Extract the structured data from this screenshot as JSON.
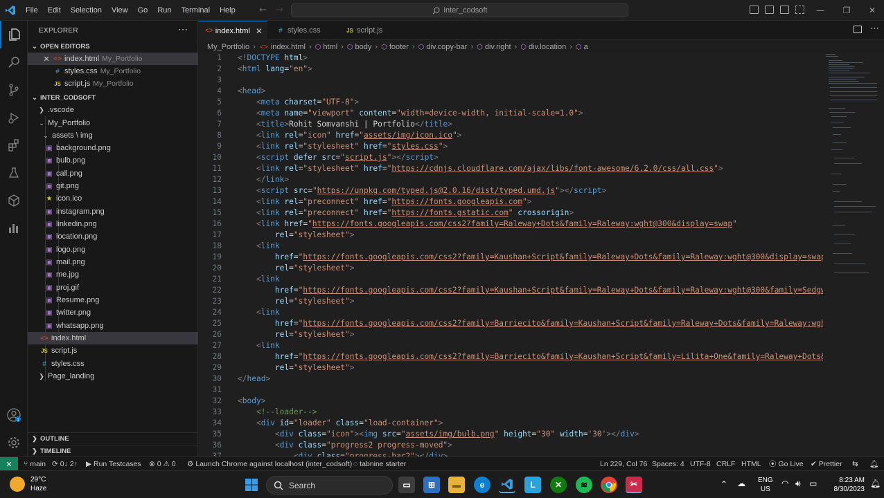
{
  "titlebar": {
    "menu": [
      "File",
      "Edit",
      "Selection",
      "View",
      "Go",
      "Run",
      "Terminal",
      "Help"
    ],
    "search": "inter_codsoft"
  },
  "sidebar": {
    "title": "EXPLORER",
    "open_editors_label": "OPEN EDITORS",
    "open_editors": [
      {
        "name": "index.html",
        "folder": "My_Portfolio",
        "icon": "html-file-icon"
      },
      {
        "name": "styles.css",
        "folder": "My_Portfolio",
        "icon": "css-file-icon"
      },
      {
        "name": "script.js",
        "folder": "My_Portfolio",
        "icon": "js-file-icon"
      }
    ],
    "workspace_label": "INTER_CODSOFT",
    "tree": [
      {
        "name": ".vscode"
      },
      {
        "name": "My_Portfolio"
      },
      {
        "name": "assets \\ img"
      },
      {
        "name": "background.png"
      },
      {
        "name": "bulb.png"
      },
      {
        "name": "call.png"
      },
      {
        "name": "git.png"
      },
      {
        "name": "icon.ico"
      },
      {
        "name": "instagram.png"
      },
      {
        "name": "linkedin.png"
      },
      {
        "name": "location.png"
      },
      {
        "name": "logo.png"
      },
      {
        "name": "mail.png"
      },
      {
        "name": "me.jpg"
      },
      {
        "name": "proj.gif"
      },
      {
        "name": "Resume.png"
      },
      {
        "name": "twitter.png"
      },
      {
        "name": "whatsapp.png"
      },
      {
        "name": "index.html"
      },
      {
        "name": "script.js"
      },
      {
        "name": "styles.css"
      },
      {
        "name": "Page_landing"
      }
    ],
    "outline_label": "OUTLINE",
    "timeline_label": "TIMELINE"
  },
  "tabs": [
    {
      "label": "index.html",
      "icon": "html-file-icon",
      "active": true
    },
    {
      "label": "styles.css",
      "icon": "css-file-icon",
      "active": false
    },
    {
      "label": "script.js",
      "icon": "js-file-icon",
      "active": false
    }
  ],
  "breadcrumb": [
    "My_Portfolio",
    "index.html",
    "html",
    "body",
    "footer",
    "div.copy-bar",
    "div.right",
    "div.location",
    "a"
  ],
  "editor": {
    "line_numbers": [
      "1",
      "2",
      "3",
      "4",
      "5",
      "6",
      "7",
      "8",
      "9",
      "10",
      "11",
      "12",
      "13",
      "14",
      "15",
      "16",
      "17",
      "18",
      "19",
      "20",
      "21",
      "22",
      "23",
      "24",
      "25",
      "26",
      "27",
      "28",
      "29",
      "30",
      "31",
      "32",
      "33",
      "34",
      "35",
      "36",
      "37"
    ]
  },
  "statusbar": {
    "branch": "main",
    "sync": "0↓ 2↑",
    "run_testcases": "Run Testcases",
    "problems": "⊗ 0 ⚠ 0",
    "launch": "Launch Chrome against localhost (inter_codsoft)",
    "tabnine": "tabnine starter",
    "position": "Ln 229, Col 76",
    "spaces": "Spaces: 4",
    "encoding": "UTF-8",
    "eol": "CRLF",
    "language": "HTML",
    "golive": "Go Live",
    "prettier": "Prettier"
  },
  "taskbar": {
    "temp": "29°C",
    "weather": "Haze",
    "search": "Search",
    "lang": "ENG",
    "region": "US",
    "time": "8:23 AM",
    "date": "8/30/2023"
  },
  "colors": {
    "accent": "#0078d4",
    "remote": "#16825d",
    "tag": "#569cd6",
    "attr": "#9cdcfe",
    "string": "#ce9178",
    "comment": "#6a9955"
  }
}
